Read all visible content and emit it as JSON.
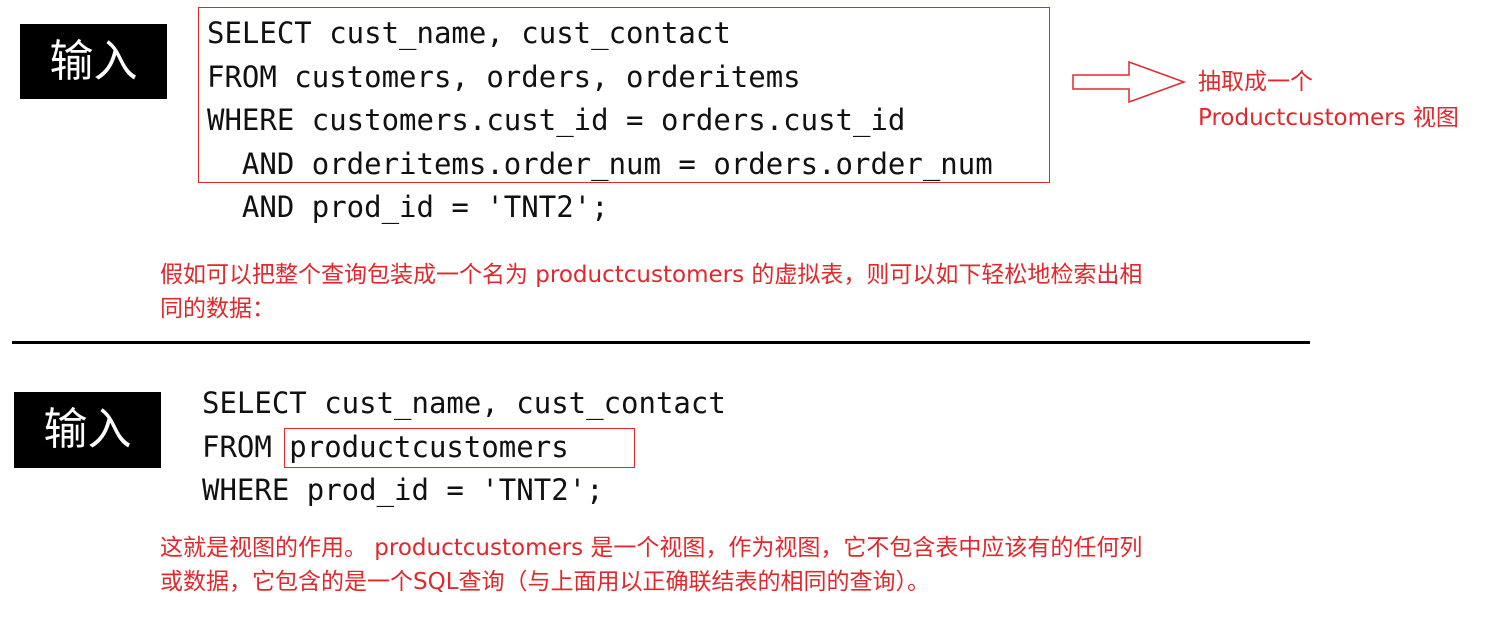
{
  "section1": {
    "badge_label": "输入",
    "code_lines": [
      "SELECT cust_name, cust_contact",
      "FROM customers, orders, orderitems",
      "WHERE customers.cust_id = orders.cust_id",
      "  AND orderitems.order_num = orders.order_num",
      "  AND prod_id = 'TNT2';"
    ],
    "side_note": {
      "line1": "抽取成一个",
      "line2": "Productcustomers 视图"
    },
    "note": {
      "line1": "假如可以把整个查询包装成一个名为 productcustomers 的虚拟表，则可以如下轻松地检索出相",
      "line2": "同的数据："
    }
  },
  "section2": {
    "badge_label": "输入",
    "code_lines": [
      "SELECT cust_name, cust_contact",
      "FROM productcustomers",
      "WHERE prod_id = 'TNT2';"
    ],
    "note": {
      "line1": "这就是视图的作用。 productcustomers 是一个视图，作为视图，它不包含表中应该有的任何列",
      "line2": "或数据，它包含的是一个SQL查询（与上面用以正确联结表的相同的查询）。"
    }
  },
  "colors": {
    "accent_red": "#e0282d",
    "badge_bg": "#000000",
    "text": "#111111"
  }
}
